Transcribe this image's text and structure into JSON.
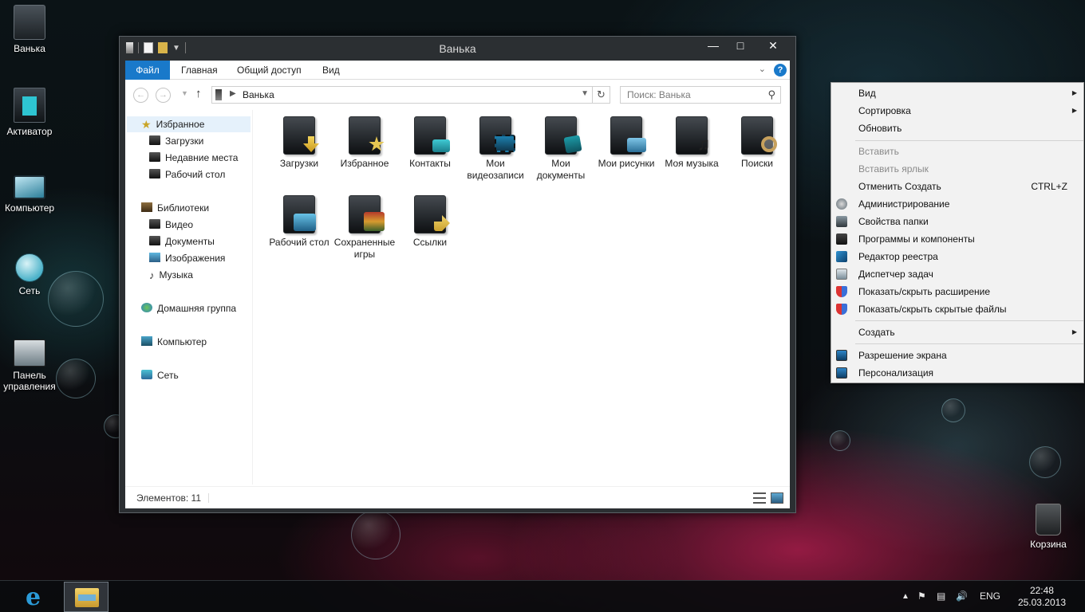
{
  "desktop": {
    "icons": [
      {
        "label": "Ванька"
      },
      {
        "label": "Активатор"
      },
      {
        "label": "Компьютер"
      },
      {
        "label": "Сеть"
      },
      {
        "label": "Панель управления"
      },
      {
        "label": "Корзина"
      }
    ]
  },
  "window": {
    "title": "Ванька",
    "ribbon_tabs": [
      "Файл",
      "Главная",
      "Общий доступ",
      "Вид"
    ],
    "help": "?",
    "address": {
      "path": "Ванька"
    },
    "search": {
      "placeholder": "Поиск: Ванька"
    },
    "nav": {
      "favorites": "Избранное",
      "fav_items": [
        "Загрузки",
        "Недавние места",
        "Рабочий стол"
      ],
      "libraries": "Библиотеки",
      "lib_items": [
        "Видео",
        "Документы",
        "Изображения",
        "Музыка"
      ],
      "homegroup": "Домашняя группа",
      "computer": "Компьютер",
      "network": "Сеть"
    },
    "items": [
      {
        "label": "Загрузки",
        "icon": "downloads-folder-icon"
      },
      {
        "label": "Избранное",
        "icon": "favorites-folder-icon"
      },
      {
        "label": "Контакты",
        "icon": "contacts-folder-icon"
      },
      {
        "label": "Мои видеозаписи",
        "icon": "videos-folder-icon"
      },
      {
        "label": "Мои документы",
        "icon": "documents-folder-icon"
      },
      {
        "label": "Мои рисунки",
        "icon": "pictures-folder-icon"
      },
      {
        "label": "Моя музыка",
        "icon": "music-folder-icon"
      },
      {
        "label": "Поиски",
        "icon": "searches-folder-icon"
      },
      {
        "label": "Рабочий стол",
        "icon": "desktop-folder-icon"
      },
      {
        "label": "Сохраненные игры",
        "icon": "saved-games-folder-icon"
      },
      {
        "label": "Ссылки",
        "icon": "links-folder-icon"
      }
    ],
    "status": {
      "count": "Элементов: 11"
    }
  },
  "context_menu": {
    "items": [
      {
        "label": "Вид",
        "submenu": true
      },
      {
        "label": "Сортировка",
        "submenu": true
      },
      {
        "label": "Обновить"
      },
      {
        "label": "Вставить",
        "disabled": true
      },
      {
        "label": "Вставить ярлык",
        "disabled": true
      },
      {
        "label": "Отменить Создать",
        "shortcut": "CTRL+Z"
      },
      {
        "label": "Администрирование",
        "icon": "admin-tools-icon"
      },
      {
        "label": "Свойства папки",
        "icon": "folder-options-icon"
      },
      {
        "label": "Программы и компоненты",
        "icon": "programs-icon"
      },
      {
        "label": "Редактор реестра",
        "icon": "registry-editor-icon"
      },
      {
        "label": "Диспетчер задач",
        "icon": "task-manager-icon"
      },
      {
        "label": "Показать/скрыть расширение",
        "icon": "shield-icon"
      },
      {
        "label": "Показать/скрыть скрытые файлы",
        "icon": "shield-icon"
      },
      {
        "label": "Создать",
        "submenu": true
      },
      {
        "label": "Разрешение экрана",
        "icon": "display-icon"
      },
      {
        "label": "Персонализация",
        "icon": "personalize-icon"
      }
    ]
  },
  "taskbar": {
    "lang": "ENG",
    "time": "22:48",
    "date": "25.03.2013"
  }
}
